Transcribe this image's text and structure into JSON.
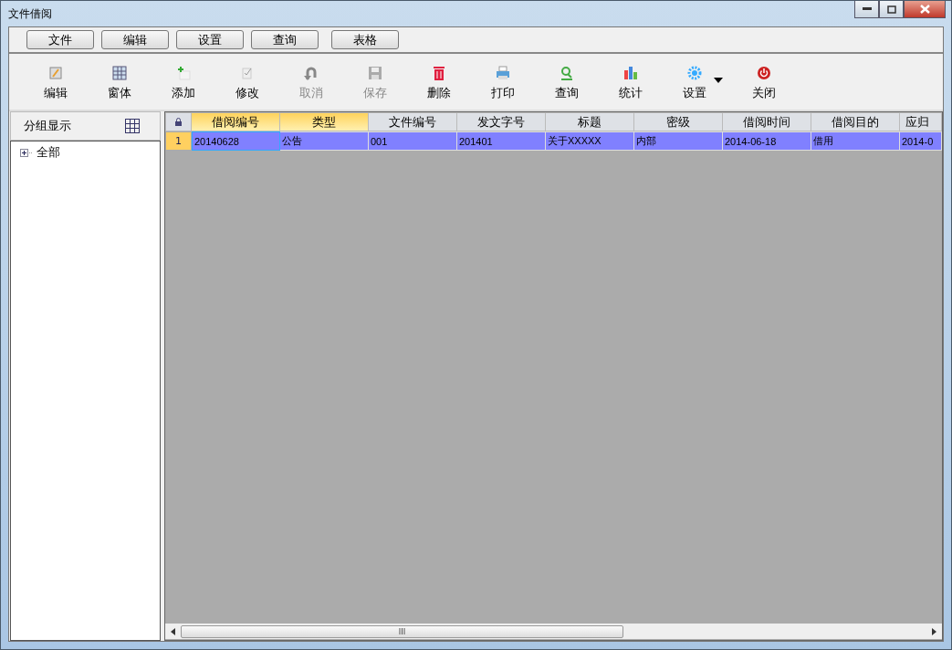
{
  "window": {
    "title": "文件借阅"
  },
  "menu": [
    "文件",
    "编辑",
    "设置",
    "查询",
    "表格"
  ],
  "toolbar": [
    {
      "kind": "edit",
      "label": "编辑",
      "disabled": false
    },
    {
      "kind": "form",
      "label": "窗体",
      "disabled": false
    },
    {
      "kind": "add",
      "label": "添加",
      "disabled": false
    },
    {
      "kind": "modify",
      "label": "修改",
      "disabled": false
    },
    {
      "kind": "undo",
      "label": "取消",
      "disabled": true
    },
    {
      "kind": "save",
      "label": "保存",
      "disabled": true
    },
    {
      "kind": "delete",
      "label": "删除",
      "disabled": false
    },
    {
      "kind": "print",
      "label": "打印",
      "disabled": false
    },
    {
      "kind": "search",
      "label": "查询",
      "disabled": false
    },
    {
      "kind": "chart",
      "label": "统计",
      "disabled": false
    },
    {
      "kind": "settings",
      "label": "设置",
      "disabled": false
    },
    {
      "kind": "power",
      "label": "关闭",
      "disabled": false
    }
  ],
  "sidebar": {
    "title": "分组显示",
    "tree": [
      {
        "label": "全部",
        "expanded": false
      }
    ]
  },
  "table": {
    "columns": [
      {
        "label": "借阅编号",
        "highlighted": true
      },
      {
        "label": "类型",
        "highlighted": true
      },
      {
        "label": "文件编号",
        "highlighted": false
      },
      {
        "label": "发文字号",
        "highlighted": false
      },
      {
        "label": "标题",
        "highlighted": false
      },
      {
        "label": "密级",
        "highlighted": false
      },
      {
        "label": "借阅时间",
        "highlighted": false
      },
      {
        "label": "借阅目的",
        "highlighted": false
      },
      {
        "label": "应归",
        "highlighted": false
      }
    ],
    "rows": [
      {
        "number": "1",
        "selected": true,
        "cells": [
          "20140628",
          "公告",
          "001",
          "201401",
          "关于XXXXX",
          "内部",
          "2014-06-18",
          "借用",
          "2014-0"
        ]
      }
    ]
  }
}
